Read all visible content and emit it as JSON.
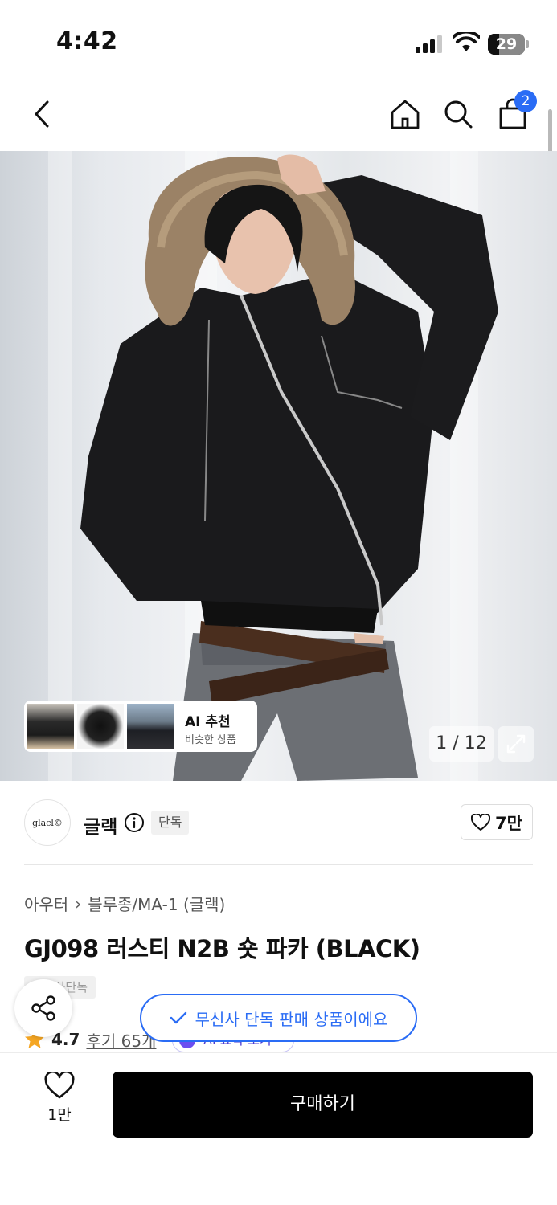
{
  "status_bar": {
    "time": "4:42",
    "battery": "29",
    "icons": [
      "signal-icon",
      "wifi-icon",
      "battery-icon"
    ]
  },
  "nav": {
    "icons": [
      "back-icon",
      "home-icon",
      "search-icon",
      "cart-icon"
    ],
    "cart_count": "2"
  },
  "gallery": {
    "counter": "1 / 12",
    "recommend": {
      "title": "AI 추천",
      "subtitle": "비슷한 상품"
    }
  },
  "brand": {
    "logo_text": "glacl©",
    "name": "글랙",
    "badge": "단독",
    "likes": "7만"
  },
  "product": {
    "breadcrumb": [
      "아우터",
      "블루종/MA-1 (글랙)"
    ],
    "title": "GJ098 러스티 N2B 숏 파카 (BLACK)",
    "exclusive_label": "무신사단독",
    "rating": "4.7",
    "reviews": "후기 65개",
    "ai_chip": "AI 요약 보기"
  },
  "toast": {
    "message": "무신사 단독 판매 상품이에요"
  },
  "bottom_bar": {
    "wish_count": "1만",
    "buy_label": "구매하기"
  },
  "colors": {
    "accent": "#2a6cf5",
    "star": "#f5a623",
    "buy_button": "#000000"
  }
}
